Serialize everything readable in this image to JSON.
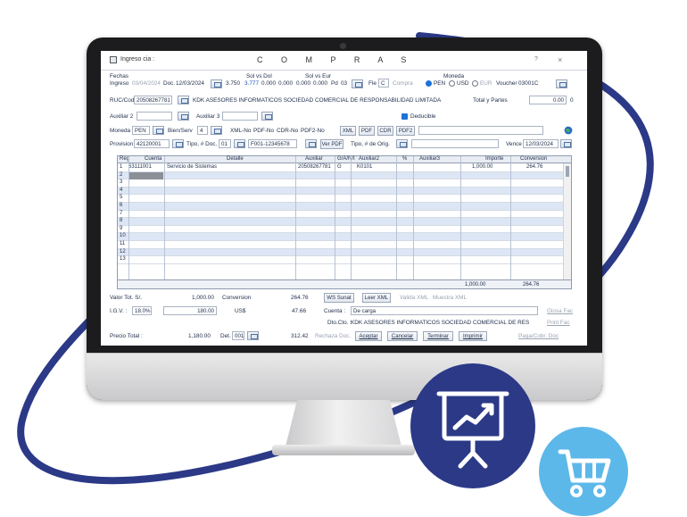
{
  "window": {
    "title": "Ingreso cia :",
    "heading": "C O M P R A S",
    "help": "?",
    "close": "×"
  },
  "header": {
    "fechas_label": "Fechas",
    "ingreso_label": "Ingreso",
    "ingreso_date": "03/04/2024",
    "doc_label": "Doc.",
    "doc_date": "12/03/2024",
    "sol_dol_label": "Sol vs Dol",
    "sol_dol_1": "3.750",
    "sol_dol_2": "3.777",
    "sol_dol_3": "0.000",
    "sol_dol_4": "0.000",
    "sol_eur_label": "Sol vs Eur",
    "sol_eur_1": "0.000",
    "sol_eur_2": "0.000",
    "pd_label": "Pd",
    "pd_value": "03",
    "fle_label": "Fle",
    "fle_value": "C",
    "compra_label": "Compra",
    "moneda_label": "Moneda",
    "pen": "PEN",
    "usd": "USD",
    "eur": "EUR",
    "voucher_label": "Voucher",
    "voucher_value": "03001C"
  },
  "ruc": {
    "label": "RUC/Cod",
    "value": "20508267781",
    "name": "KDK ASESORES INFORMATICOS SOCIEDAD COMERCIAL DE RESPONSABILIDAD LIMITADA",
    "total_label": "Total y Partes",
    "total_value": "0.00",
    "total_extra": "0"
  },
  "aux": {
    "aux2_label": "Auxiliar 2",
    "aux3_label": "Auxiliar 3",
    "deducible": "Deducible"
  },
  "moneda_row": {
    "label": "Moneda",
    "value": "PEN",
    "bien_label": "Bien/Serv",
    "bien_value": "4",
    "xml_no": "XML-No",
    "pdf_no": "PDF-No",
    "cdr_no": "CDR-No",
    "pdf2_no": "PDF2-No",
    "xml": "XML",
    "pdf": "PDF",
    "cdr": "CDR",
    "pdf2": "PDF2"
  },
  "prov_row": {
    "label": "Provision",
    "value": "42120001",
    "tipo_label": "Tipo, # Doc.",
    "tipo_value": "01",
    "doc_value": "F001-12345678",
    "ver_pdf": "Ver PDF",
    "tipo_orig": "Tipo, # de Orig.",
    "vence_label": "Vence",
    "vence_value": "12/03/2024"
  },
  "grid": {
    "columns": [
      "Reg",
      "Cuenta",
      "Detalle",
      "Auxiliar",
      "G/A/N/I",
      "Auxiliar2",
      "%",
      "Auxiliar3",
      "Importe",
      "Conversion"
    ],
    "rows": [
      {
        "reg": "1",
        "cuenta": "63111001",
        "detalle": "Servicio de Sistemas",
        "auxiliar": "20508267781",
        "gani": "G",
        "aux2": "K0101",
        "importe": "1,000.00",
        "conversion": "264.76"
      },
      {
        "reg": "2"
      },
      {
        "reg": "3"
      },
      {
        "reg": "4"
      },
      {
        "reg": "5"
      },
      {
        "reg": "6"
      },
      {
        "reg": "7"
      },
      {
        "reg": "8"
      },
      {
        "reg": "9"
      },
      {
        "reg": "10"
      },
      {
        "reg": "11"
      },
      {
        "reg": "12"
      },
      {
        "reg": "13"
      }
    ],
    "total_importe": "1,000.00",
    "total_conversion": "264.76"
  },
  "totals": {
    "valor_label": "Valor Tot. S/.",
    "valor": "1,000.00",
    "conversion_label": "Conversion",
    "conversion": "264.76",
    "ws_sunat": "WS Sunat",
    "leer_xml": "Leer XML",
    "valida_xml": "Valida XML",
    "muestra_xml": "Muestra XML",
    "igv_label": "I.G.V. :",
    "igv_rate": "18.0%",
    "igv": "180.00",
    "us_label": "US$",
    "us_value": "47.66",
    "cuenta_label": "Cuenta :",
    "cuenta_value": "De carga",
    "glosa": "Glosa Fac",
    "dcto_label": "Dto.Cto. :",
    "dcto_value": "KDK ASESORES INFORMATICOS SOCIEDAD COMERCIAL DE RES",
    "print": "Print Fac",
    "precio_label": "Precio Total :",
    "precio": "1,180.00",
    "det_label": "Det.",
    "det_value": "001",
    "precio_usd": "312.42",
    "rechaza": "Rechaza Doc.",
    "aceptar": "Aceptar",
    "cancelar": "Cancelar",
    "terminar": "Terminar",
    "imprimir": "Imprimir",
    "paga": "Paga/Cobr. Doc"
  },
  "icons": {
    "chart": "presentation-chart-icon",
    "cart": "shopping-cart-icon"
  },
  "colors": {
    "navy": "#2b3987",
    "sky": "#5db8ea",
    "accent": "#1e73d6"
  }
}
